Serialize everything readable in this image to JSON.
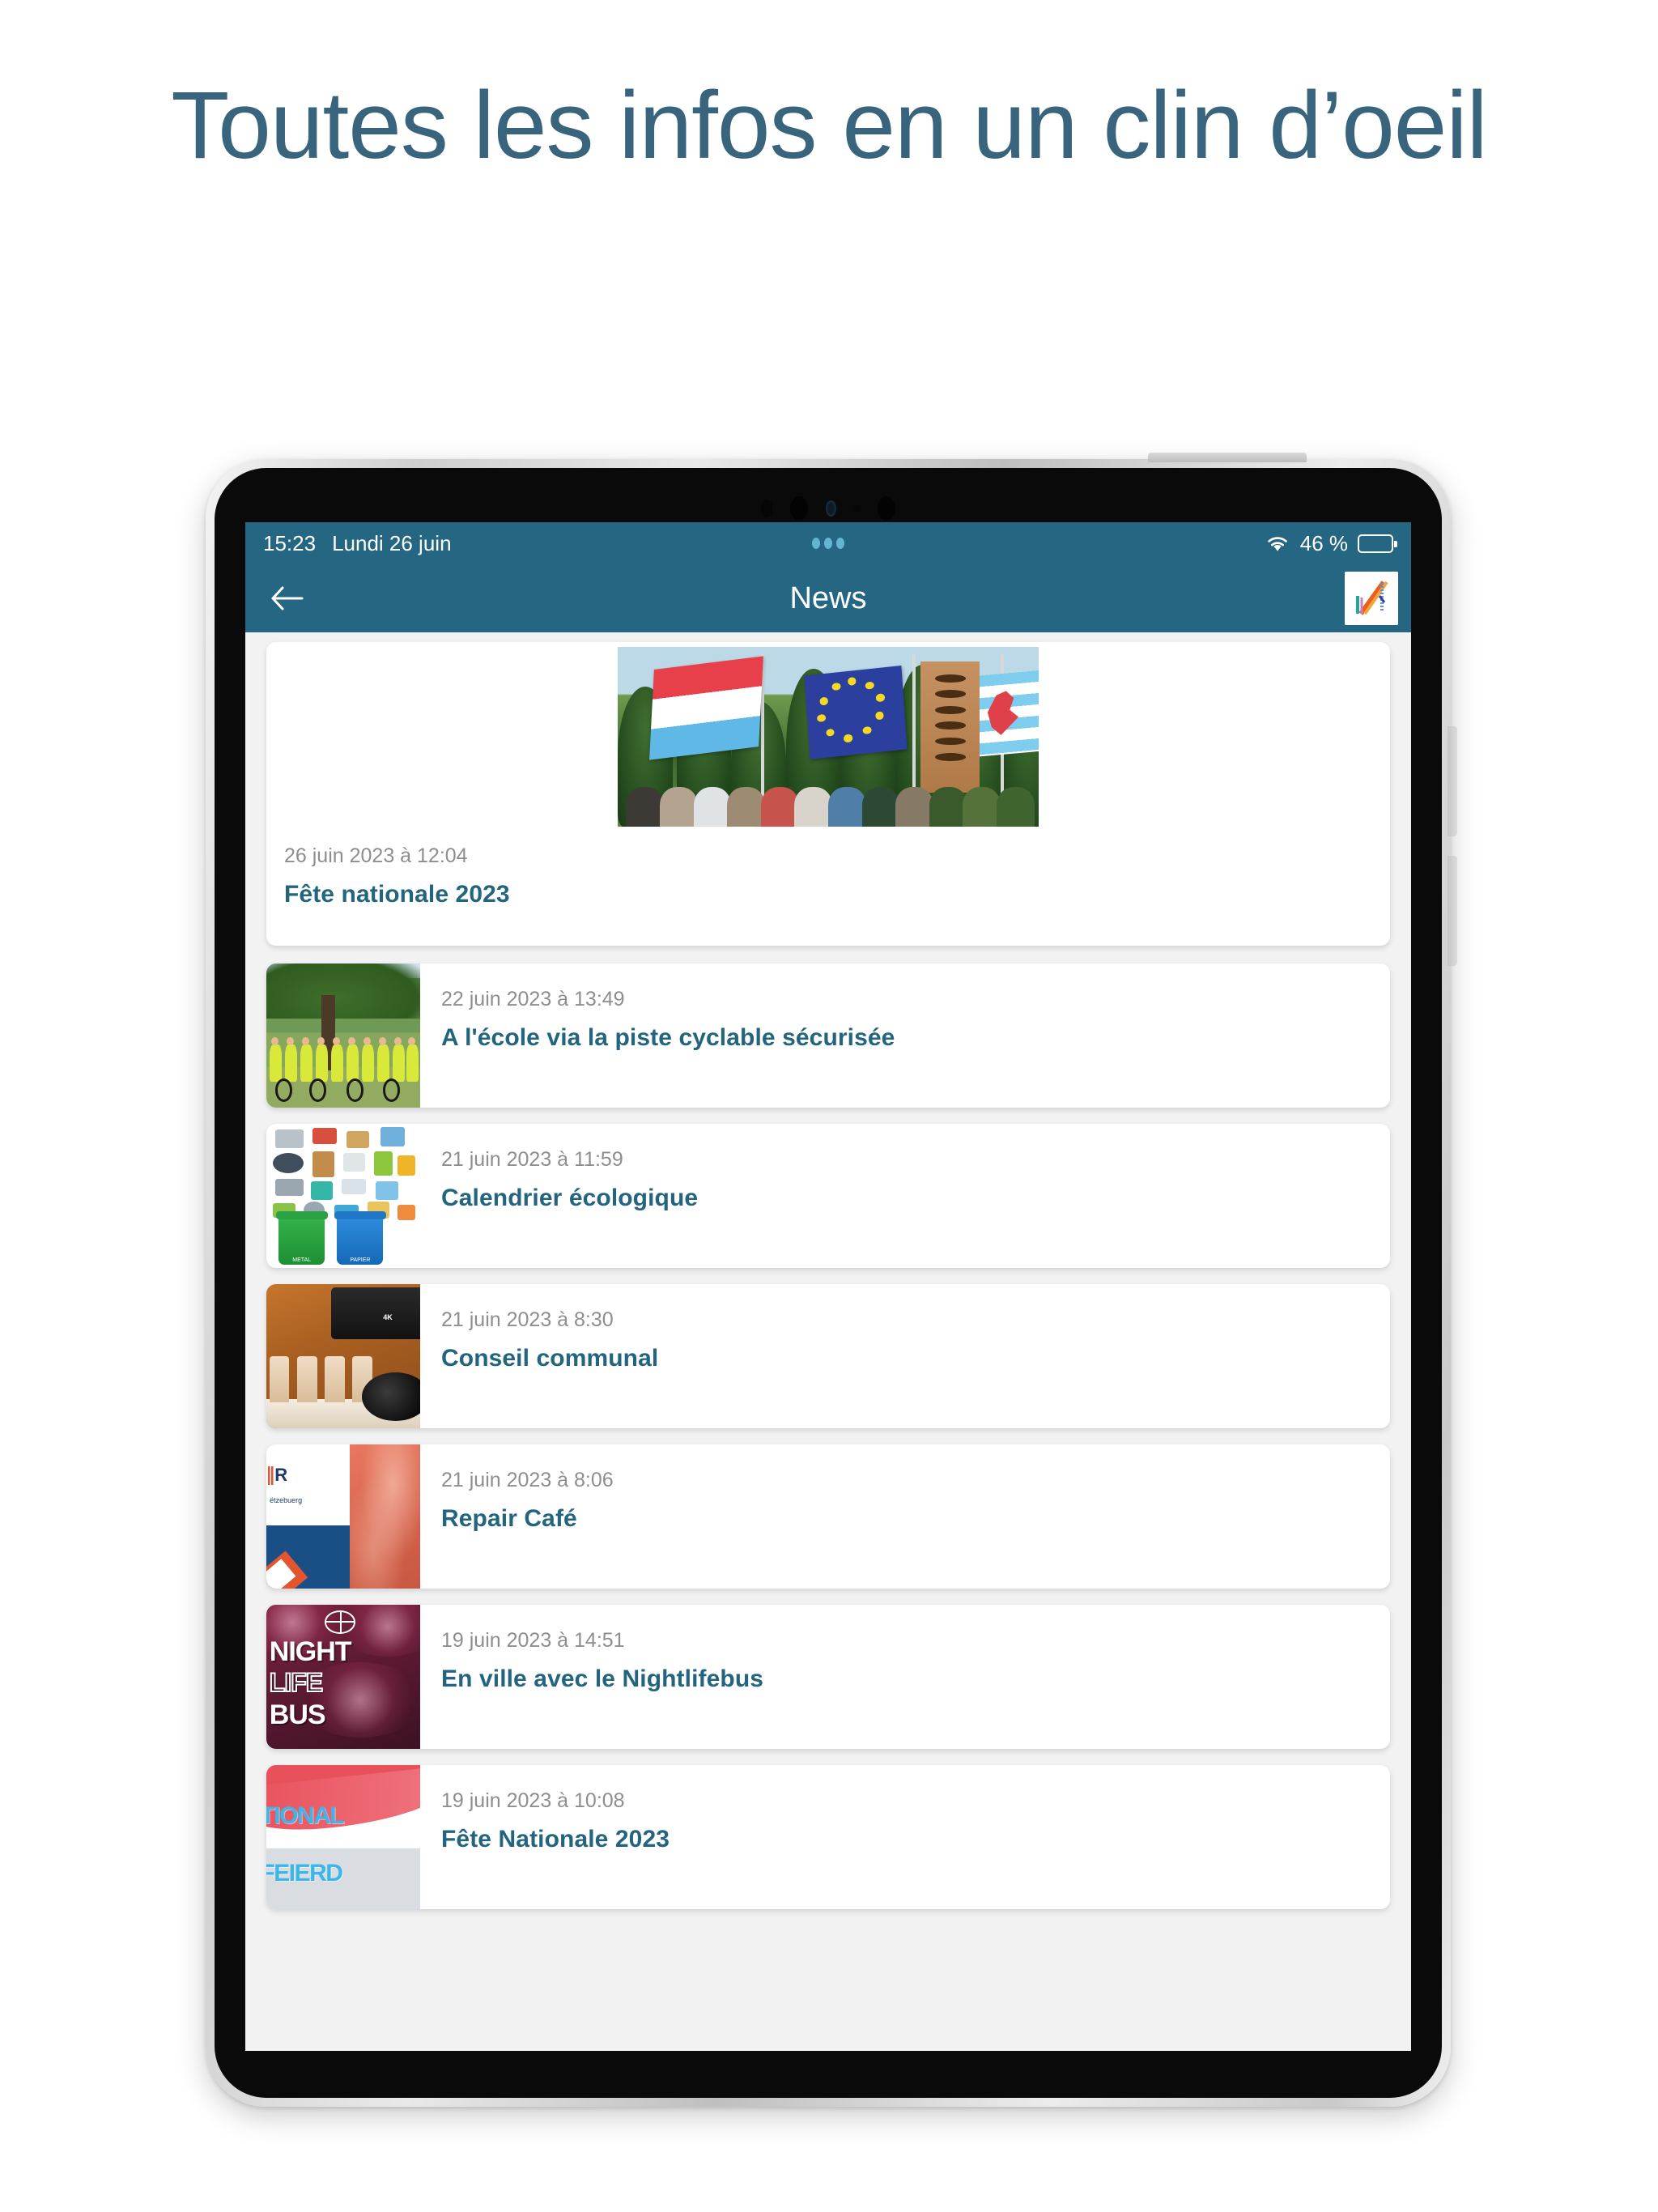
{
  "promo": {
    "heading": "Toutes les infos en un clin d’oeil",
    "heading_color": "#38657d"
  },
  "device": {
    "type": "tablet",
    "buttons": [
      "power-button",
      "volume-up-button",
      "volume-down-button"
    ]
  },
  "statusbar": {
    "time": "15:23",
    "date": "Lundi 26 juin",
    "wifi_icon": "wifi-icon",
    "battery_percent": "46 %",
    "battery_level": 46,
    "background_color": "#256783"
  },
  "navbar": {
    "back_icon": "back-arrow-icon",
    "title": "News",
    "logo_name": "app-logo-n",
    "background_color": "#256783"
  },
  "theme": {
    "accent": "#256783",
    "title_color": "#23647f",
    "date_color": "#8e8e8e",
    "list_background": "#f2f2f2",
    "card_background": "#ffffff"
  },
  "news": {
    "featured": {
      "date": "26 juin 2023 à 12:04",
      "title": "Fête nationale 2023",
      "image_name": "flags-ceremony-photo"
    },
    "items": [
      {
        "date": "22 juin 2023 à 13:49",
        "title": "A l'école via la piste cyclable sécurisée",
        "image_name": "school-cycling-group-photo"
      },
      {
        "date": "21 juin 2023 à 11:59",
        "title": "Calendrier écologique",
        "image_name": "recycling-bins-illustration"
      },
      {
        "date": "21 juin 2023 à 8:30",
        "title": "Conseil communal",
        "image_name": "council-chamber-camera-photo"
      },
      {
        "date": "21 juin 2023 à 8:06",
        "title": "Repair Café",
        "image_name": "repair-cafe-poster"
      },
      {
        "date": "19 juin 2023 à 14:51",
        "title": "En ville avec le Nightlifebus",
        "image_name": "nightlifebus-poster"
      },
      {
        "date": "19 juin 2023 à 10:08",
        "title": "Fête Nationale 2023",
        "image_name": "national-feierdag-poster"
      }
    ]
  },
  "thumb_art": {
    "nightlifebus_lines": [
      "NIGHT",
      "LIFE",
      "BUS"
    ],
    "national_lines": [
      "TIONAL",
      "FEIERD"
    ],
    "repair_logo": "R",
    "repair_sub": "ëtzebuerg",
    "recycling_labels": [
      "METAL",
      "PAPIER"
    ],
    "council_tag": "4K"
  }
}
